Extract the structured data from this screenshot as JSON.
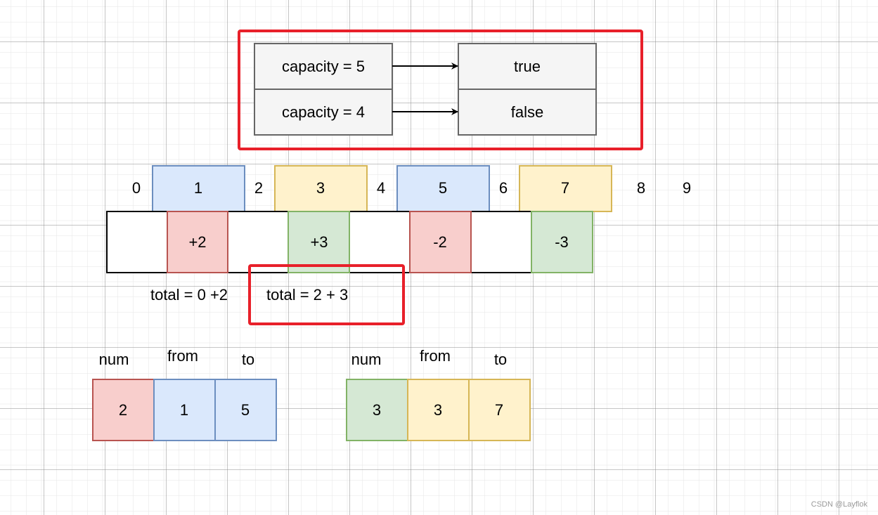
{
  "colors": {
    "highlight_red": "#e8202a",
    "gray_fill": "#f5f5f5",
    "gray_stroke": "#666666",
    "blue_fill": "#dae8fc",
    "blue_stroke": "#6c8ebf",
    "yellow_fill": "#fff2cc",
    "yellow_stroke": "#d6b656",
    "red_fill": "#f8cecc",
    "red_stroke": "#b85450",
    "green_fill": "#d5e8d4",
    "green_stroke": "#82b366"
  },
  "capacity_map": {
    "rows": [
      {
        "input": "capacity = 5",
        "output": "true"
      },
      {
        "input": "capacity = 4",
        "output": "false"
      }
    ]
  },
  "positions": {
    "plain": [
      "0",
      "2",
      "4",
      "6",
      "8",
      "9"
    ],
    "boxed": [
      {
        "label": "1",
        "color": "blue"
      },
      {
        "label": "3",
        "color": "yellow"
      },
      {
        "label": "5",
        "color": "blue"
      },
      {
        "label": "7",
        "color": "yellow"
      }
    ]
  },
  "deltas": [
    "+2",
    "+3",
    "-2",
    "-3"
  ],
  "totals": [
    "total = 0 +2",
    "total = 2 + 3"
  ],
  "trips": [
    {
      "headers": [
        "num",
        "from",
        "to"
      ],
      "values": [
        "2",
        "1",
        "5"
      ]
    },
    {
      "headers": [
        "num",
        "from",
        "to"
      ],
      "values": [
        "3",
        "3",
        "7"
      ]
    }
  ],
  "watermark": "CSDN @Layflok"
}
